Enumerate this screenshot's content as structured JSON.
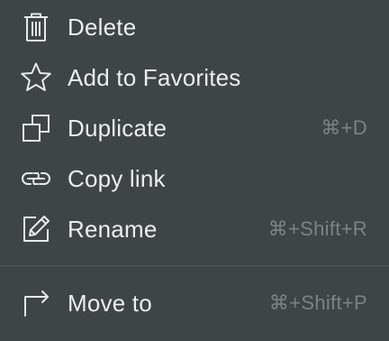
{
  "menu": {
    "items": [
      {
        "icon": "trash-icon",
        "label": "Delete",
        "shortcut": ""
      },
      {
        "icon": "star-icon",
        "label": "Add to Favorites",
        "shortcut": ""
      },
      {
        "icon": "duplicate-icon",
        "label": "Duplicate",
        "shortcut": "⌘+D"
      },
      {
        "icon": "link-icon",
        "label": "Copy link",
        "shortcut": ""
      },
      {
        "icon": "pencil-icon",
        "label": "Rename",
        "shortcut": "⌘+Shift+R"
      },
      {
        "icon": "move-arrow-icon",
        "label": "Move to",
        "shortcut": "⌘+Shift+P"
      }
    ]
  },
  "colors": {
    "background": "#3f4447",
    "text": "#eceded",
    "shortcut_text": "#7d8286",
    "divider": "#52575b"
  }
}
